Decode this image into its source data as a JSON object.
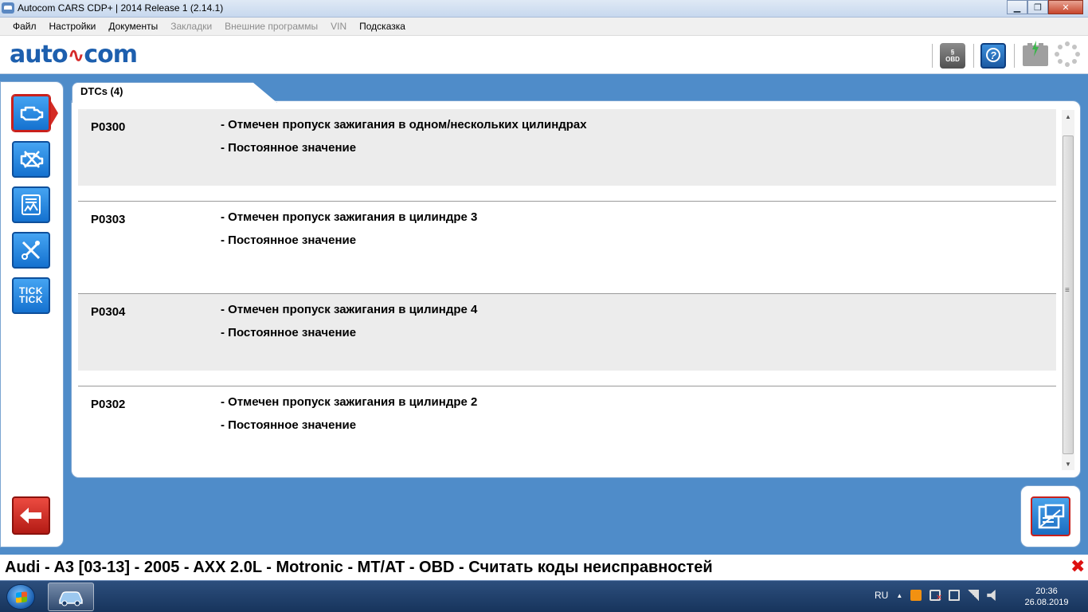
{
  "window": {
    "title": "Autocom CARS CDP+ | 2014 Release 1 (2.14.1)",
    "minimize": "▁",
    "maximize": "❐",
    "close": "✕"
  },
  "menu": [
    {
      "label": "Файл",
      "enabled": true
    },
    {
      "label": "Настройки",
      "enabled": true
    },
    {
      "label": "Документы",
      "enabled": true
    },
    {
      "label": "Закладки",
      "enabled": false
    },
    {
      "label": "Внешние программы",
      "enabled": false
    },
    {
      "label": "VIN",
      "enabled": false
    },
    {
      "label": "Подсказка",
      "enabled": true
    }
  ],
  "logo": {
    "left": "auto",
    "wave": "∿",
    "right": "com"
  },
  "toolbar": {
    "obd_label_top": "§",
    "obd_label_bottom": "OBD",
    "help_label": "?"
  },
  "sidebar": {
    "items": [
      {
        "name": "engine-icon",
        "active": true
      },
      {
        "name": "engine-crossed-icon",
        "active": false
      },
      {
        "name": "data-graph-icon",
        "active": false
      },
      {
        "name": "tools-icon",
        "active": false
      },
      {
        "name": "tick-tick-icon",
        "label_top": "TICK",
        "label_bottom": "TICK",
        "active": false
      }
    ],
    "back": "back-arrow-icon"
  },
  "tab": {
    "label": "DTCs (4)"
  },
  "dtcs": [
    {
      "code": "P0300",
      "description": "- Отмечен пропуск зажигания в одном/нескольких цилиндрах",
      "status": "- Постоянное значение",
      "shaded": true
    },
    {
      "code": "P0303",
      "description": "- Отмечен пропуск зажигания в цилиндре 3",
      "status": "- Постоянное значение",
      "shaded": false
    },
    {
      "code": "P0304",
      "description": "- Отмечен пропуск зажигания в цилиндре 4",
      "status": "- Постоянное значение",
      "shaded": true
    },
    {
      "code": "P0302",
      "description": "- Отмечен пропуск зажигания в цилиндре 2",
      "status": "- Постоянное значение",
      "shaded": false
    }
  ],
  "statusbar": {
    "text": "Audi - A3 [03-13] - 2005 - AXX 2.0L - Motronic - MT/AT - OBD - Считать коды неисправностей",
    "close": "✖"
  },
  "taskbar": {
    "language": "RU",
    "tray_up": "▲",
    "time": "20:36",
    "date": "26.08.2019"
  },
  "colors": {
    "accent_blue": "#1d5fae",
    "active_red": "#c9201c",
    "background": "#4f8cc9"
  }
}
